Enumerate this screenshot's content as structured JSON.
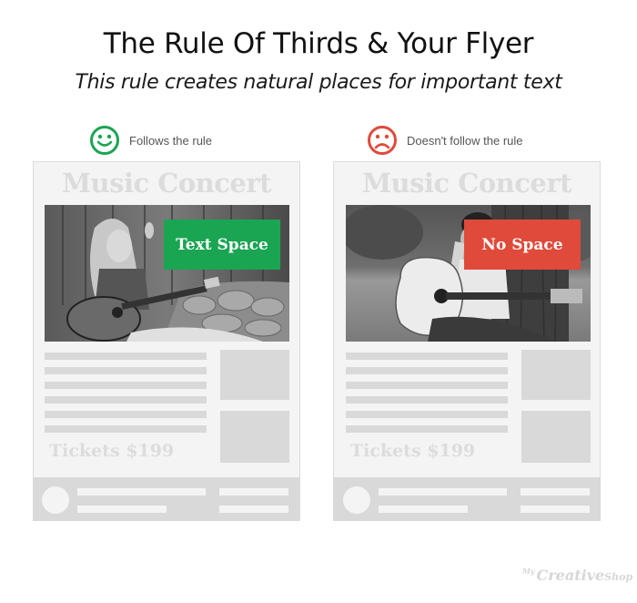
{
  "header": {
    "title": "The Rule Of Thirds & Your Flyer",
    "subtitle": "This rule creates natural places for important text"
  },
  "examples": [
    {
      "status_icon": "smiley-face-icon",
      "status_color": "#1aa552",
      "status_label": "Follows the rule",
      "flyer": {
        "heading": "Music Concert",
        "photo": "woman-playing-guitar-against-wooden-wall",
        "tag_label": "Text Space",
        "tag_color": "#1aa552",
        "tickets": "Tickets $199"
      }
    },
    {
      "status_icon": "sad-face-icon",
      "status_color": "#e04a3a",
      "status_label": "Doesn't follow the rule",
      "flyer": {
        "heading": "Music Concert",
        "photo": "woman-playing-guitar-by-tree",
        "tag_label": "No Space",
        "tag_color": "#e04a3a",
        "tickets": "Tickets $199"
      }
    }
  ],
  "brand": {
    "my": "My",
    "name": "Creative",
    "suffix": "Shop"
  }
}
